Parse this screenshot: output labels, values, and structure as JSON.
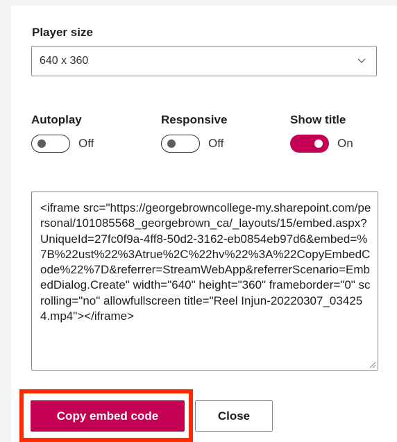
{
  "player_size": {
    "label": "Player size",
    "selected": "640 x 360",
    "icon": "chevron-down-icon"
  },
  "toggles": {
    "autoplay": {
      "label": "Autoplay",
      "state": "Off",
      "on": false
    },
    "responsive": {
      "label": "Responsive",
      "state": "Off",
      "on": false
    },
    "show_title": {
      "label": "Show title",
      "state": "On",
      "on": true
    }
  },
  "embed_code": "<iframe src=\"https://georgebrowncollege-my.sharepoint.com/personal/101085568_georgebrown_ca/_layouts/15/embed.aspx?UniqueId=27fc0f9a-4ff8-50d2-3162-eb0854eb97d6&embed=%7B%22ust%22%3Atrue%2C%22hv%22%3A%22CopyEmbedCode%22%7D&referrer=StreamWebApp&referrerScenario=EmbedDialog.Create\" width=\"640\" height=\"360\" frameborder=\"0\" scrolling=\"no\" allowfullscreen title=\"Reel Injun-20220307_034254.mp4\"></iframe>",
  "buttons": {
    "copy": "Copy embed code",
    "close": "Close"
  },
  "colors": {
    "accent": "#c30052",
    "highlight_frame": "#ff2a00"
  }
}
